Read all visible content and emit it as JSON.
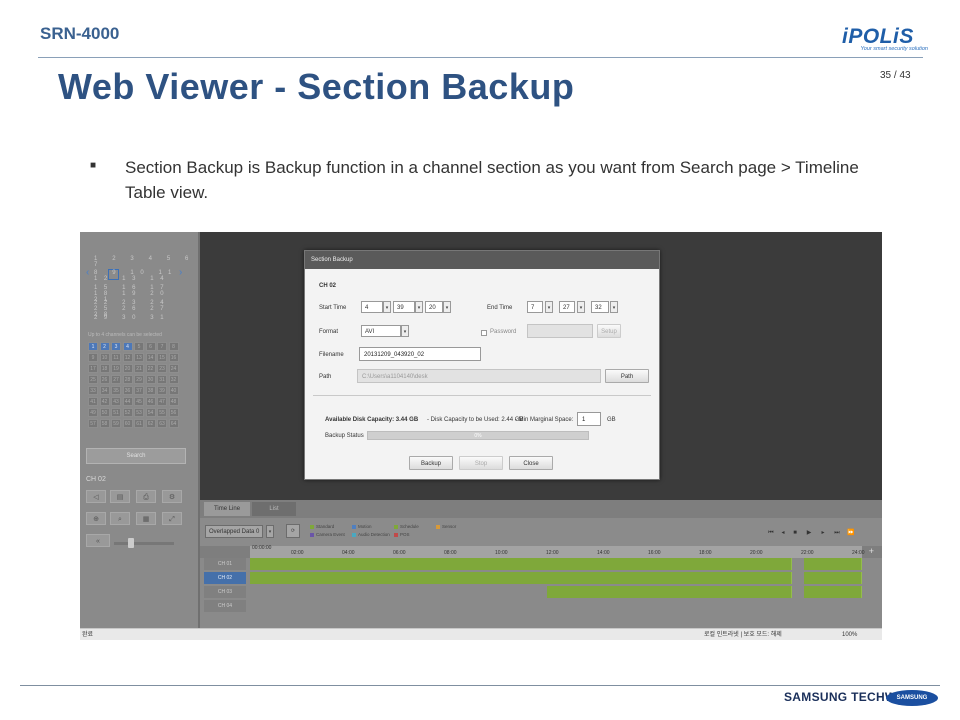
{
  "slide": {
    "model": "SRN-4000",
    "brand": "iPOLiS",
    "brand_tagline": "Your smart security solution",
    "page": "35 / 43",
    "title": "Web Viewer - Section Backup",
    "bullet_text": "Section Backup is Backup function in a channel section as you want from Search page > Timeline Table view.",
    "footer_brand": "SAMSUNG TECHWIN",
    "footer_logo": "SAMSUNG"
  },
  "calendar": {
    "rows": [
      "1 2 3 4 5 6 7",
      "8 9 10 11 12 13 14",
      "15 16 17 18 19 20 21",
      "22 23 24 25 26 27 28",
      "29 30 31"
    ],
    "prev_icon": "chevron-left-icon",
    "next_icon": "chevron-right-icon"
  },
  "channel_panel": {
    "note": "Up to 4 channels can be selected",
    "channels": [
      "1",
      "2",
      "3",
      "4",
      "5",
      "6",
      "7",
      "8",
      "9",
      "10",
      "11",
      "12",
      "13",
      "14",
      "15",
      "16",
      "17",
      "18",
      "19",
      "20",
      "21",
      "22",
      "23",
      "24",
      "25",
      "26",
      "27",
      "28",
      "29",
      "30",
      "31",
      "32",
      "33",
      "34",
      "35",
      "36",
      "37",
      "38",
      "39",
      "40",
      "41",
      "42",
      "43",
      "44",
      "45",
      "46",
      "47",
      "48",
      "49",
      "50",
      "51",
      "52",
      "53",
      "54",
      "55",
      "56",
      "57",
      "58",
      "59",
      "60",
      "61",
      "62",
      "63",
      "64"
    ],
    "selected": [
      1,
      2,
      3,
      4
    ],
    "search_label": "Search",
    "ch_label": "CH 02"
  },
  "dialog": {
    "title": "Section Backup",
    "channel": "CH 02",
    "start_time_label": "Start Time",
    "start_h": "4",
    "start_m": "39",
    "start_s": "20",
    "end_time_label": "End Time",
    "end_h": "7",
    "end_m": "27",
    "end_s": "32",
    "format_label": "Format",
    "format_value": "AVI",
    "password_label": "Password",
    "setup_label": "Setup",
    "filename_label": "Filename",
    "filename_value": "20131209_043920_02",
    "path_label": "Path",
    "path_value": "C:\\Users\\a1104140\\desk",
    "path_button": "Path",
    "available_label": "Available Disk Capacity: 3.44 GB",
    "used_label": "- Disk Capacity to be Used: 2.44 GB",
    "margin_label": "- Min Marginal Space:",
    "margin_value": "1",
    "margin_unit": "GB",
    "status_label": "Backup Status",
    "progress_text": "0%",
    "backup_btn": "Backup",
    "stop_btn": "Stop",
    "close_btn": "Close"
  },
  "timeline": {
    "tab_timeline": "Time Line",
    "tab_list": "List",
    "overlap_select": "Overlapped Data 0",
    "legend": [
      {
        "label": "Standard",
        "color": "#7fa83a"
      },
      {
        "label": "Motion",
        "color": "#4f7fc0"
      },
      {
        "label": "Schedule",
        "color": "#7fa83a"
      },
      {
        "label": "Sensor",
        "color": "#d89a3a"
      },
      {
        "label": "Camera Event",
        "color": "#6a55a8"
      },
      {
        "label": "Audio Detection",
        "color": "#4aa8c0"
      },
      {
        "label": "POS",
        "color": "#c04a4a"
      }
    ],
    "time_readout": "00:00:00",
    "hours": [
      "00:00",
      "02:00",
      "04:00",
      "06:00",
      "08:00",
      "10:00",
      "12:00",
      "14:00",
      "16:00",
      "18:00",
      "20:00",
      "22:00",
      "24:00"
    ],
    "rows": [
      "CH 01",
      "CH 02",
      "CH 03",
      "CH 04"
    ],
    "zoom_in": "+",
    "zoom_out": "−"
  },
  "statusbar": {
    "left": "완료",
    "zone": "로컬 인트라넷 | 보호 모드: 해제",
    "zoom": "100%"
  }
}
